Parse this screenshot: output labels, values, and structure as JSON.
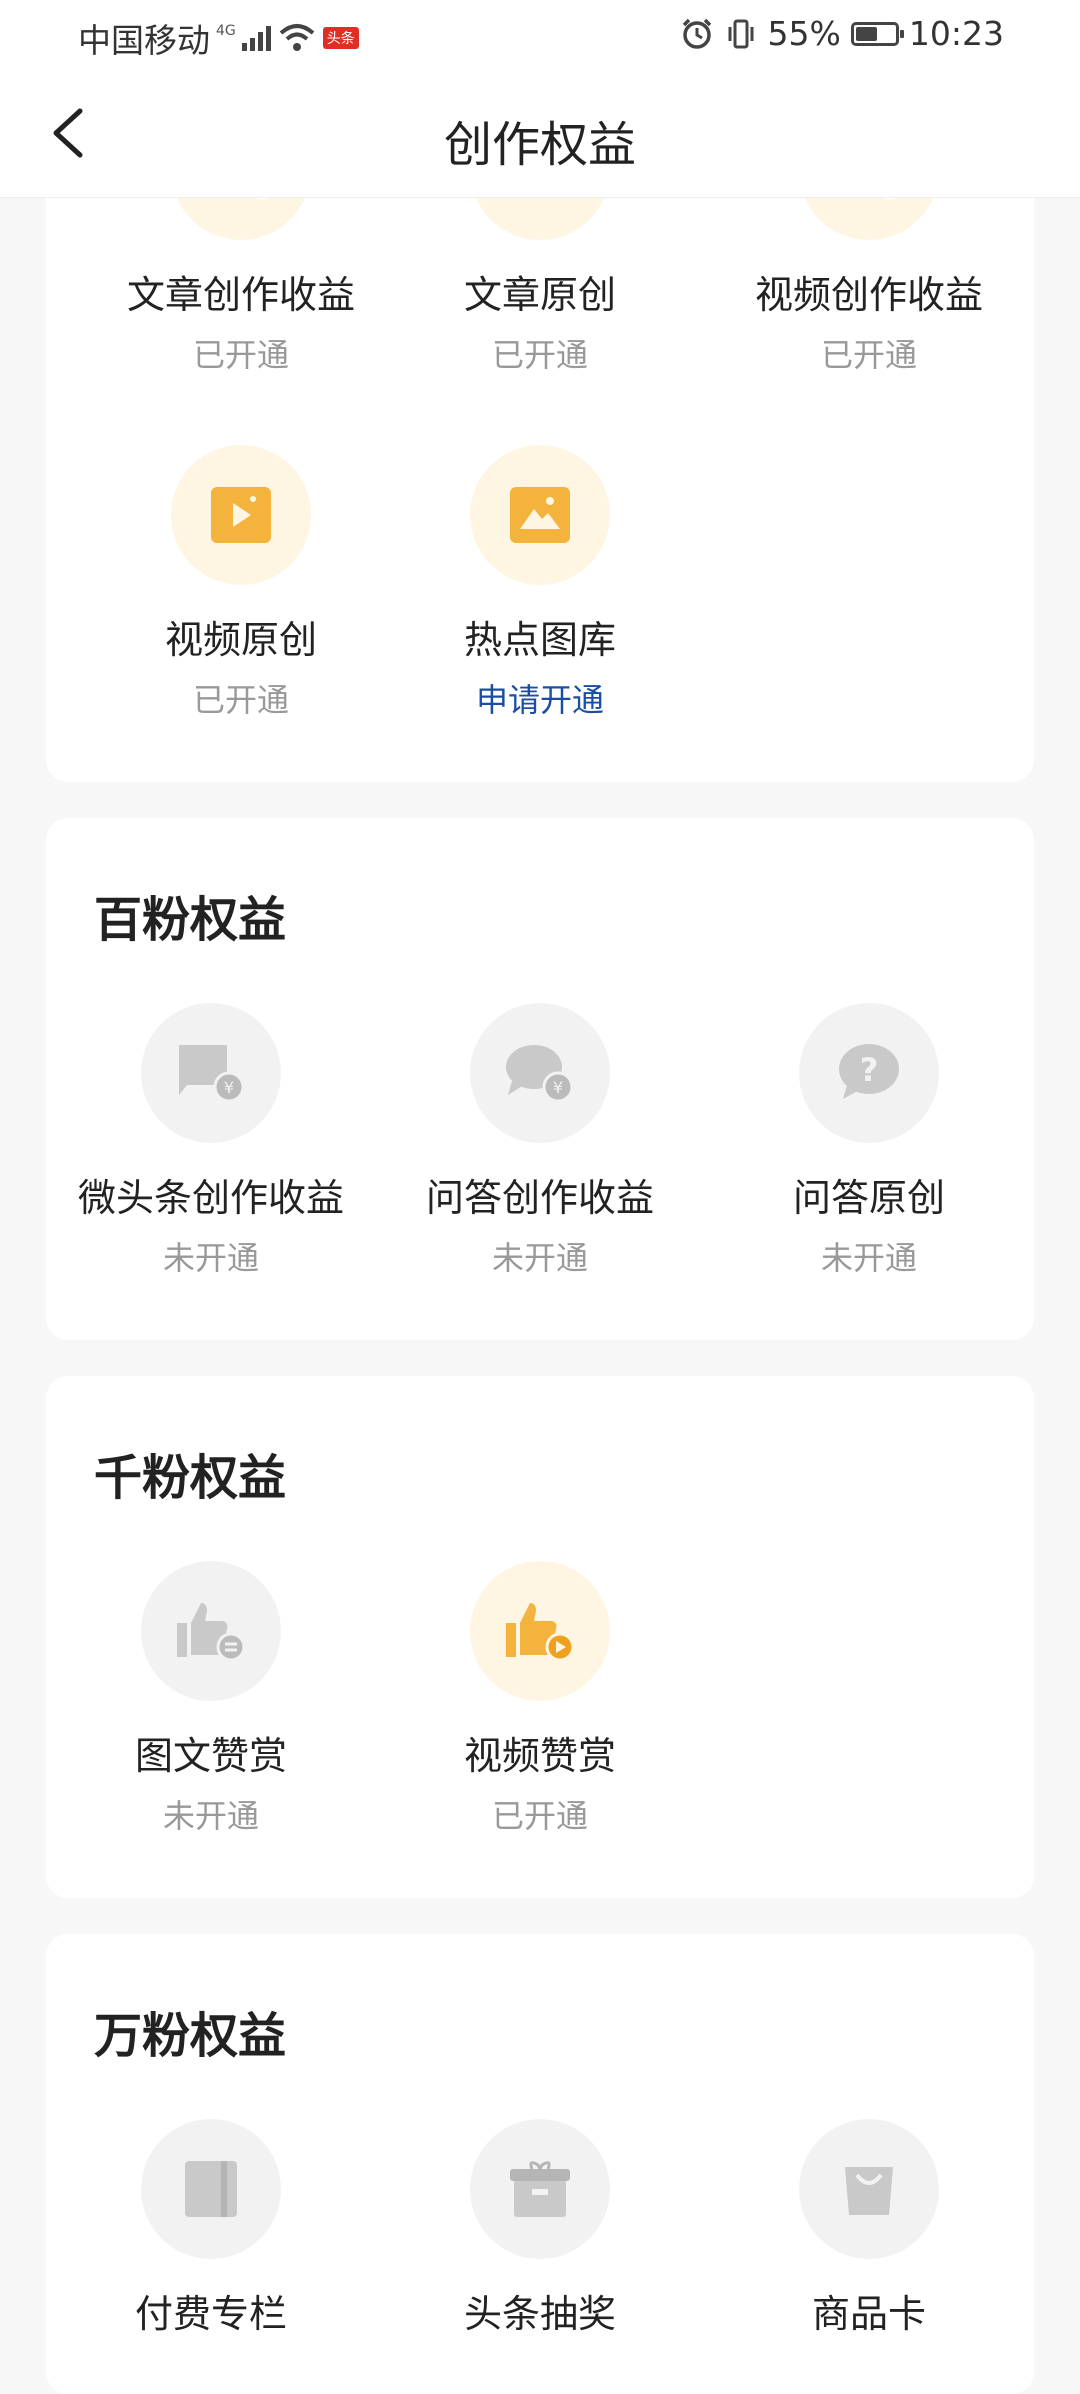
{
  "status_bar": {
    "carrier": "中国移动",
    "network": "4G",
    "app_badge": "头条",
    "battery": "55%",
    "battery_level": 0.55,
    "time": "10:23"
  },
  "nav": {
    "title": "创作权益"
  },
  "sections": [
    {
      "items": [
        {
          "label": "文章创作收益",
          "status": "已开通"
        },
        {
          "label": "文章原创",
          "status": "已开通"
        },
        {
          "label": "视频创作收益",
          "status": "已开通"
        },
        {
          "label": "视频原创",
          "status": "已开通"
        },
        {
          "label": "热点图库",
          "status": "申请开通"
        }
      ]
    },
    {
      "title": "百粉权益",
      "items": [
        {
          "label": "微头条创作收益",
          "status": "未开通"
        },
        {
          "label": "问答创作收益",
          "status": "未开通"
        },
        {
          "label": "问答原创",
          "status": "未开通"
        }
      ]
    },
    {
      "title": "千粉权益",
      "items": [
        {
          "label": "图文赞赏",
          "status": "未开通"
        },
        {
          "label": "视频赞赏",
          "status": "已开通"
        }
      ]
    },
    {
      "title": "万粉权益",
      "items": [
        {
          "label": "付费专栏"
        },
        {
          "label": "头条抽奖"
        },
        {
          "label": "商品卡"
        }
      ]
    }
  ],
  "colors": {
    "gold_icon": "#f3b33d",
    "gold_bg": "#fff5e3",
    "grey_icon": "#c9c9c9",
    "grey_bg": "#f2f2f2",
    "apply_link": "#1b4ea3"
  }
}
